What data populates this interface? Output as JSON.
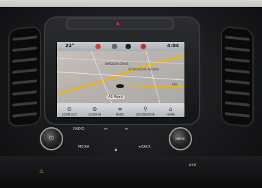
{
  "status_bar": {
    "temperature": "22°",
    "time": "4:04",
    "icons": [
      "phone-icon",
      "media-icon",
      "settings-icon",
      "nav-icon"
    ]
  },
  "map": {
    "street_labels": [
      "WINDSOR GRAVE",
      "ST NICHOLAS AVENUE",
      "EXE"
    ],
    "road_name": "A1 Road",
    "route_color": "#e3b51f",
    "position_marker_color": "#1a1a1a"
  },
  "screen_bottom_bar": {
    "buttons": [
      {
        "label": "ZOOM OUT",
        "icon": "zoom-out-icon"
      },
      {
        "label": "ZOOM IN",
        "icon": "zoom-in-icon"
      },
      {
        "label": "MENU",
        "icon": "menu-icon"
      },
      {
        "label": "DESTINATION",
        "icon": "destination-icon"
      },
      {
        "label": "HOME",
        "icon": "home-icon"
      }
    ]
  },
  "controls": {
    "radio": "RADIO",
    "media": "MEDIA",
    "back": "◂ BACK",
    "menu": "MENU",
    "prev": "⏮",
    "next": "⏭",
    "eject": "▲"
  },
  "lower_panel": {
    "eco": "eco"
  }
}
